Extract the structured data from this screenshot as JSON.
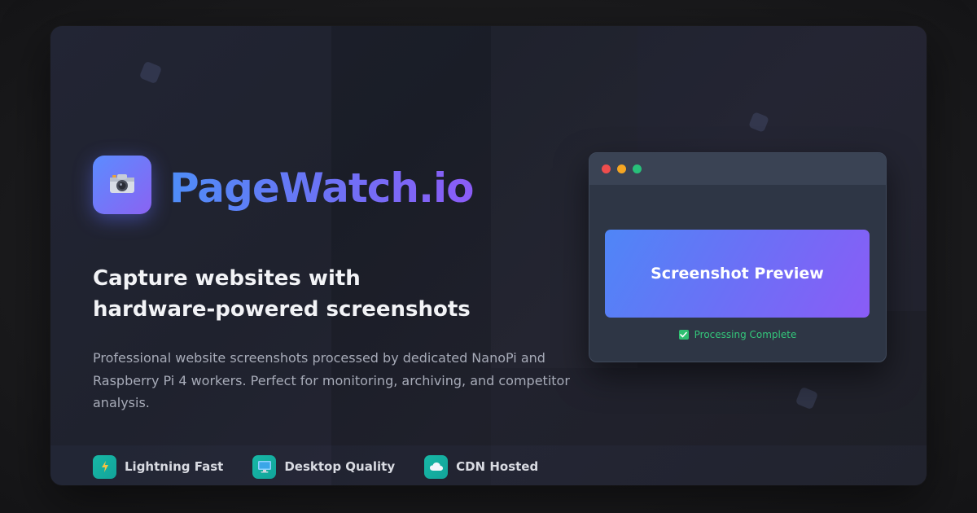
{
  "brand": {
    "name": "PageWatch.io",
    "logo_icon": "camera-icon"
  },
  "hero": {
    "headline_line1": "Capture websites with",
    "headline_line2": "hardware-powered screenshots",
    "description": "Professional website screenshots processed by dedicated NanoPi and Raspberry Pi 4 workers. Perfect for monitoring, archiving, and competitor analysis."
  },
  "features": [
    {
      "label": "Lightning Fast",
      "icon": "lightning-icon"
    },
    {
      "label": "Desktop Quality",
      "icon": "desktop-icon"
    },
    {
      "label": "CDN Hosted",
      "icon": "cloud-icon"
    }
  ],
  "preview_window": {
    "window_controls": [
      "close",
      "minimize",
      "maximize"
    ],
    "preview_label": "Screenshot Preview",
    "status_text": "Processing Complete",
    "status_icon": "checkmark-icon"
  },
  "colors": {
    "accent_blue": "#4f86f7",
    "accent_purple": "#8a5cf6",
    "feature_teal": "#17b8a6",
    "status_green": "#34c77b",
    "dot_red": "#ef4d4d",
    "dot_yellow": "#f5a623",
    "dot_green": "#28c07a"
  }
}
